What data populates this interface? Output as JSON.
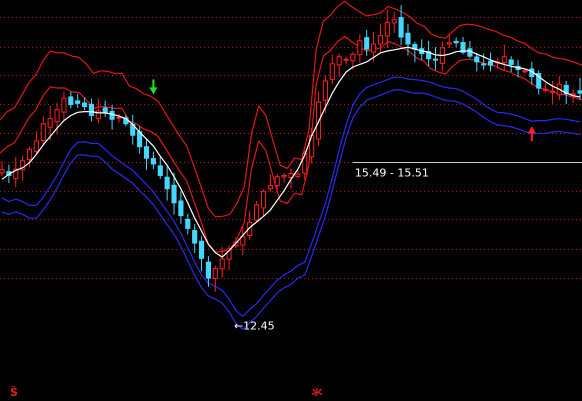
{
  "chart_data": {
    "type": "candlestick",
    "xlabel": "",
    "ylabel": "",
    "ylim": [
      11.0,
      16.8
    ],
    "grid": true,
    "legend": "none",
    "colors": {
      "background": "#000000",
      "grid": "#b01818",
      "up_candle": "#ff2020",
      "down_candle": "#44d8ff",
      "midline": "#ffffff",
      "upper_bands": "#e01818",
      "lower_bands": "#2a2aee",
      "price_line": "#c8c8c8",
      "annotation_text": "#ffffff",
      "buy_marker": "#ff2020",
      "sell_marker": "#20e020",
      "marker_glyph": "#e02020"
    },
    "grid_levels": [
      16.53,
      16.07,
      15.62,
      15.17,
      14.71,
      14.26,
      13.81,
      13.36,
      12.9,
      12.45
    ],
    "closes": [
      14.14,
      14.05,
      14.15,
      14.28,
      14.46,
      14.59,
      14.86,
      14.94,
      15.08,
      15.26,
      15.16,
      15.18,
      15.13,
      14.99,
      15.06,
      15.04,
      14.93,
      14.96,
      14.86,
      14.68,
      14.5,
      14.32,
      14.23,
      14.05,
      13.84,
      13.62,
      13.42,
      13.22,
      12.99,
      12.75,
      12.44,
      12.59,
      12.74,
      12.9,
      13.0,
      13.09,
      13.31,
      13.59,
      13.8,
      13.89,
      14.03,
      14.05,
      14.08,
      14.07,
      14.39,
      14.68,
      15.2,
      15.53,
      15.8,
      15.91,
      15.87,
      15.95,
      16.16,
      16.03,
      16.11,
      16.24,
      16.45,
      16.49,
      16.22,
      16.11,
      16.03,
      15.96,
      15.88,
      15.86,
      16.05,
      16.13,
      16.13,
      15.98,
      15.92,
      15.83,
      15.79,
      15.78,
      15.83,
      15.91,
      15.79,
      15.71,
      15.69,
      15.6,
      15.42,
      15.4,
      15.37,
      15.48,
      15.33,
      15.33,
      15.34
    ],
    "upper_band_1": [
      14.92,
      15.05,
      15.11,
      15.3,
      15.5,
      15.63,
      15.85,
      16.0,
      15.97,
      15.97,
      15.92,
      15.9,
      15.8,
      15.65,
      15.69,
      15.68,
      15.65,
      15.65,
      15.45,
      15.41,
      15.33,
      15.29,
      15.21,
      15.03,
      14.85,
      14.67,
      14.51,
      14.19,
      13.87,
      13.53,
      13.4,
      13.41,
      13.44,
      13.62,
      13.87,
      14.7,
      15.14,
      14.99,
      14.59,
      14.21,
      14.16,
      14.32,
      14.3,
      14.77,
      16.02,
      16.47,
      16.56,
      16.7,
      16.78,
      16.69,
      16.62,
      16.55,
      16.57,
      16.6,
      16.7,
      16.66,
      16.61,
      16.54,
      16.44,
      16.39,
      16.27,
      16.22,
      16.2,
      16.31,
      16.4,
      16.42,
      16.41,
      16.38,
      16.34,
      16.31,
      16.25,
      16.22,
      16.16,
      16.12,
      16.04,
      15.97,
      15.95,
      15.9,
      15.88,
      15.86,
      15.82,
      15.78
    ],
    "upper_band_2": [
      14.4,
      14.5,
      14.56,
      14.75,
      14.95,
      15.08,
      15.3,
      15.44,
      15.42,
      15.42,
      15.36,
      15.35,
      15.24,
      15.1,
      15.13,
      15.12,
      15.1,
      15.1,
      14.9,
      14.86,
      14.78,
      14.74,
      14.66,
      14.48,
      14.3,
      14.12,
      13.96,
      13.64,
      13.32,
      12.97,
      12.85,
      12.86,
      12.89,
      13.06,
      13.32,
      14.15,
      14.59,
      14.44,
      14.04,
      13.65,
      13.61,
      13.77,
      13.75,
      14.22,
      15.47,
      15.92,
      16.01,
      16.15,
      16.23,
      16.14,
      16.07,
      16.0,
      16.02,
      16.05,
      16.15,
      16.11,
      16.06,
      15.99,
      15.89,
      15.84,
      15.72,
      15.67,
      15.64,
      15.76,
      15.85,
      15.87,
      15.86,
      15.82,
      15.79,
      15.76,
      15.7,
      15.67,
      15.61,
      15.57,
      15.49,
      15.42,
      15.4,
      15.35,
      15.33,
      15.3,
      15.27,
      15.23
    ],
    "midline": [
      13.99,
      14.07,
      14.13,
      14.17,
      14.25,
      14.38,
      14.53,
      14.66,
      14.79,
      14.91,
      14.99,
      15.04,
      15.05,
      15.05,
      15.03,
      15.03,
      15.01,
      14.98,
      14.94,
      14.85,
      14.73,
      14.62,
      14.51,
      14.35,
      14.21,
      14.03,
      13.84,
      13.62,
      13.38,
      13.18,
      12.97,
      12.84,
      12.77,
      12.87,
      12.99,
      13.11,
      13.23,
      13.32,
      13.41,
      13.51,
      13.66,
      13.81,
      13.99,
      14.15,
      14.37,
      14.67,
      14.89,
      15.12,
      15.34,
      15.52,
      15.67,
      15.75,
      15.79,
      15.83,
      15.9,
      15.97,
      16.0,
      16.02,
      16.04,
      16.06,
      16.03,
      16.0,
      15.98,
      15.94,
      15.93,
      15.95,
      15.99,
      16.0,
      16.0,
      15.95,
      15.91,
      15.86,
      15.82,
      15.79,
      15.76,
      15.74,
      15.72,
      15.68,
      15.6,
      15.52,
      15.45,
      15.4,
      15.34,
      15.3,
      15.28
    ],
    "lower_band_1": [
      13.7,
      13.64,
      13.68,
      13.64,
      13.58,
      13.58,
      13.71,
      13.88,
      14.05,
      14.26,
      14.46,
      14.57,
      14.58,
      14.55,
      14.55,
      14.46,
      14.36,
      14.28,
      14.2,
      14.13,
      14.02,
      13.91,
      13.79,
      13.64,
      13.49,
      13.33,
      13.14,
      12.92,
      12.69,
      12.49,
      12.36,
      12.31,
      12.25,
      12.11,
      11.93,
      11.84,
      11.95,
      12.04,
      12.17,
      12.29,
      12.41,
      12.49,
      12.55,
      12.64,
      12.69,
      12.98,
      13.3,
      13.61,
      14.01,
      14.45,
      14.84,
      15.15,
      15.33,
      15.43,
      15.47,
      15.51,
      15.55,
      15.59,
      15.59,
      15.56,
      15.55,
      15.54,
      15.52,
      15.48,
      15.44,
      15.42,
      15.41,
      15.37,
      15.31,
      15.24,
      15.16,
      15.09,
      15.04,
      15.03,
      15.01,
      14.98,
      14.94,
      14.9,
      14.91,
      14.91,
      14.93,
      14.94,
      14.93,
      14.91,
      14.89
    ],
    "lower_band_2": [
      13.48,
      13.44,
      13.48,
      13.44,
      13.38,
      13.38,
      13.51,
      13.67,
      13.85,
      14.06,
      14.25,
      14.37,
      14.37,
      14.35,
      14.35,
      14.26,
      14.15,
      14.08,
      14.0,
      13.93,
      13.81,
      13.71,
      13.59,
      13.43,
      13.28,
      13.13,
      12.94,
      12.71,
      12.48,
      12.29,
      12.16,
      12.11,
      12.05,
      11.91,
      11.73,
      11.64,
      11.74,
      11.84,
      11.97,
      12.09,
      12.21,
      12.29,
      12.34,
      12.44,
      12.49,
      12.78,
      13.1,
      13.41,
      13.81,
      14.24,
      14.64,
      14.95,
      15.12,
      15.23,
      15.27,
      15.31,
      15.35,
      15.39,
      15.39,
      15.36,
      15.34,
      15.34,
      15.32,
      15.28,
      15.24,
      15.22,
      15.21,
      15.17,
      15.11,
      15.04,
      14.96,
      14.89,
      14.84,
      14.83,
      14.81,
      14.78,
      14.74,
      14.7,
      14.71,
      14.71,
      14.73,
      14.74,
      14.72,
      14.71,
      14.69
    ],
    "crosshair_value": 14.26,
    "annotations": [
      {
        "text": "15.49 - 15.51",
        "close_index": 51
      },
      {
        "text": "←12.45",
        "close_index": 34
      }
    ],
    "markers": [
      {
        "type": "sell-arrow",
        "close_index": 22
      },
      {
        "type": "buy-arrow",
        "close_index": 77
      }
    ],
    "bottom_labels": [
      {
        "glyph": "Š",
        "position": "left"
      },
      {
        "glyph": "氺",
        "position": "center"
      }
    ]
  }
}
